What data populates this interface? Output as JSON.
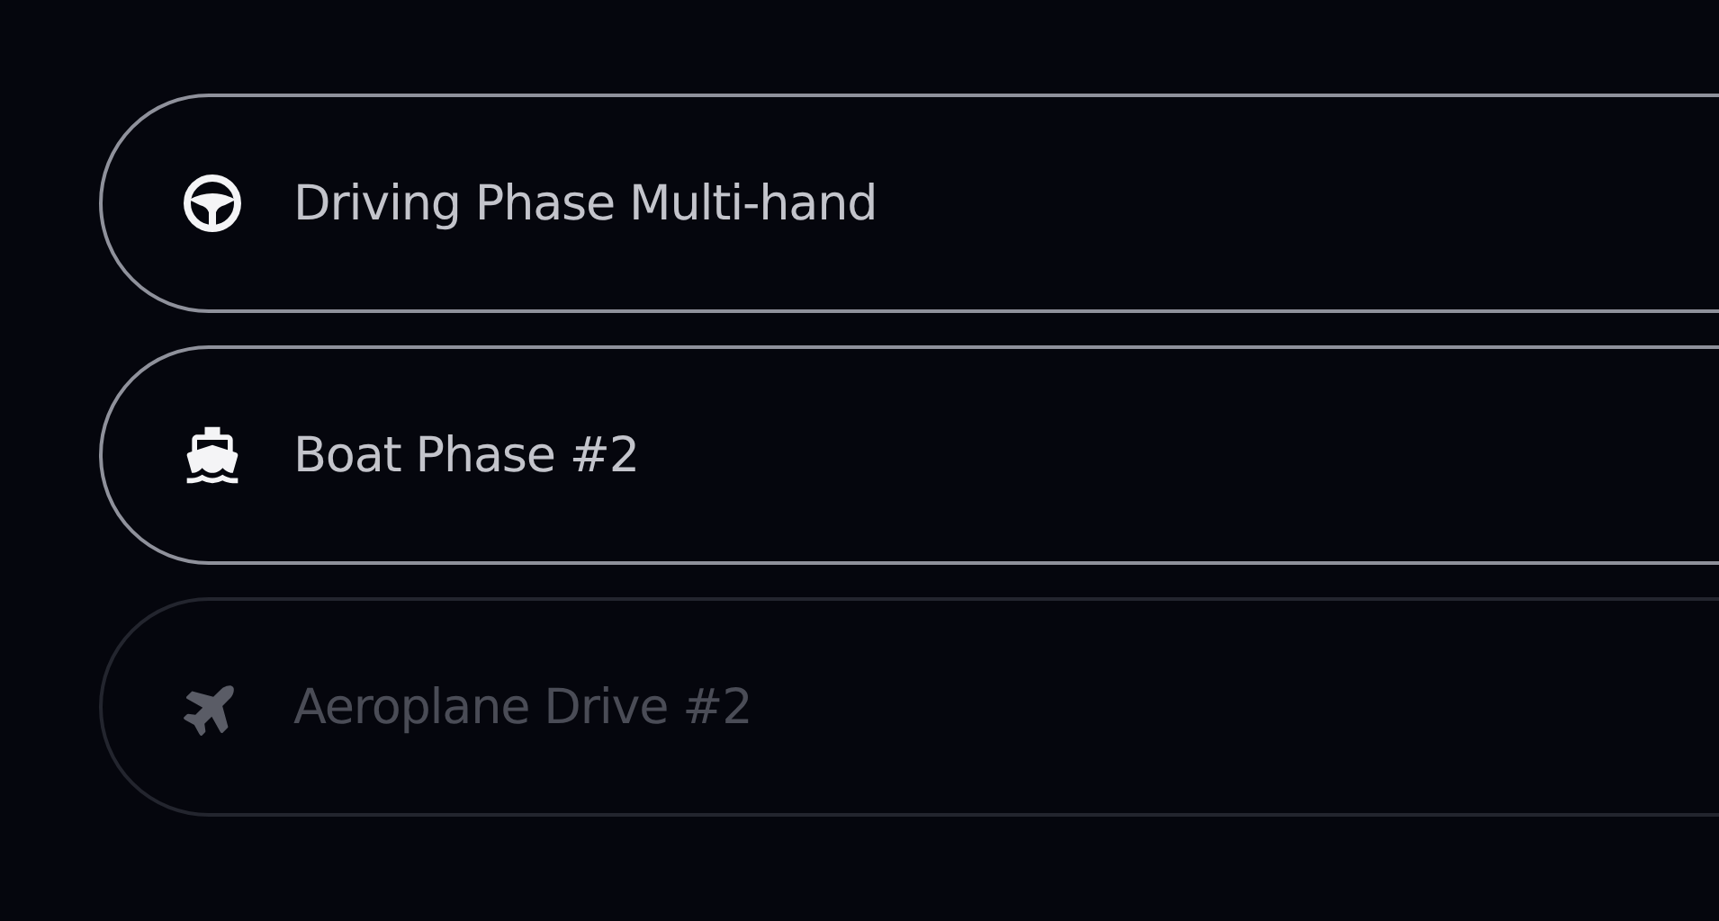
{
  "items": [
    {
      "kind": "wheel",
      "label": "Driving Phase Multi-hand",
      "disabled": false
    },
    {
      "kind": "boat",
      "label": "Boat Phase #2",
      "disabled": false
    },
    {
      "kind": "plane",
      "label": "Aeroplane Drive #2",
      "disabled": true
    }
  ]
}
